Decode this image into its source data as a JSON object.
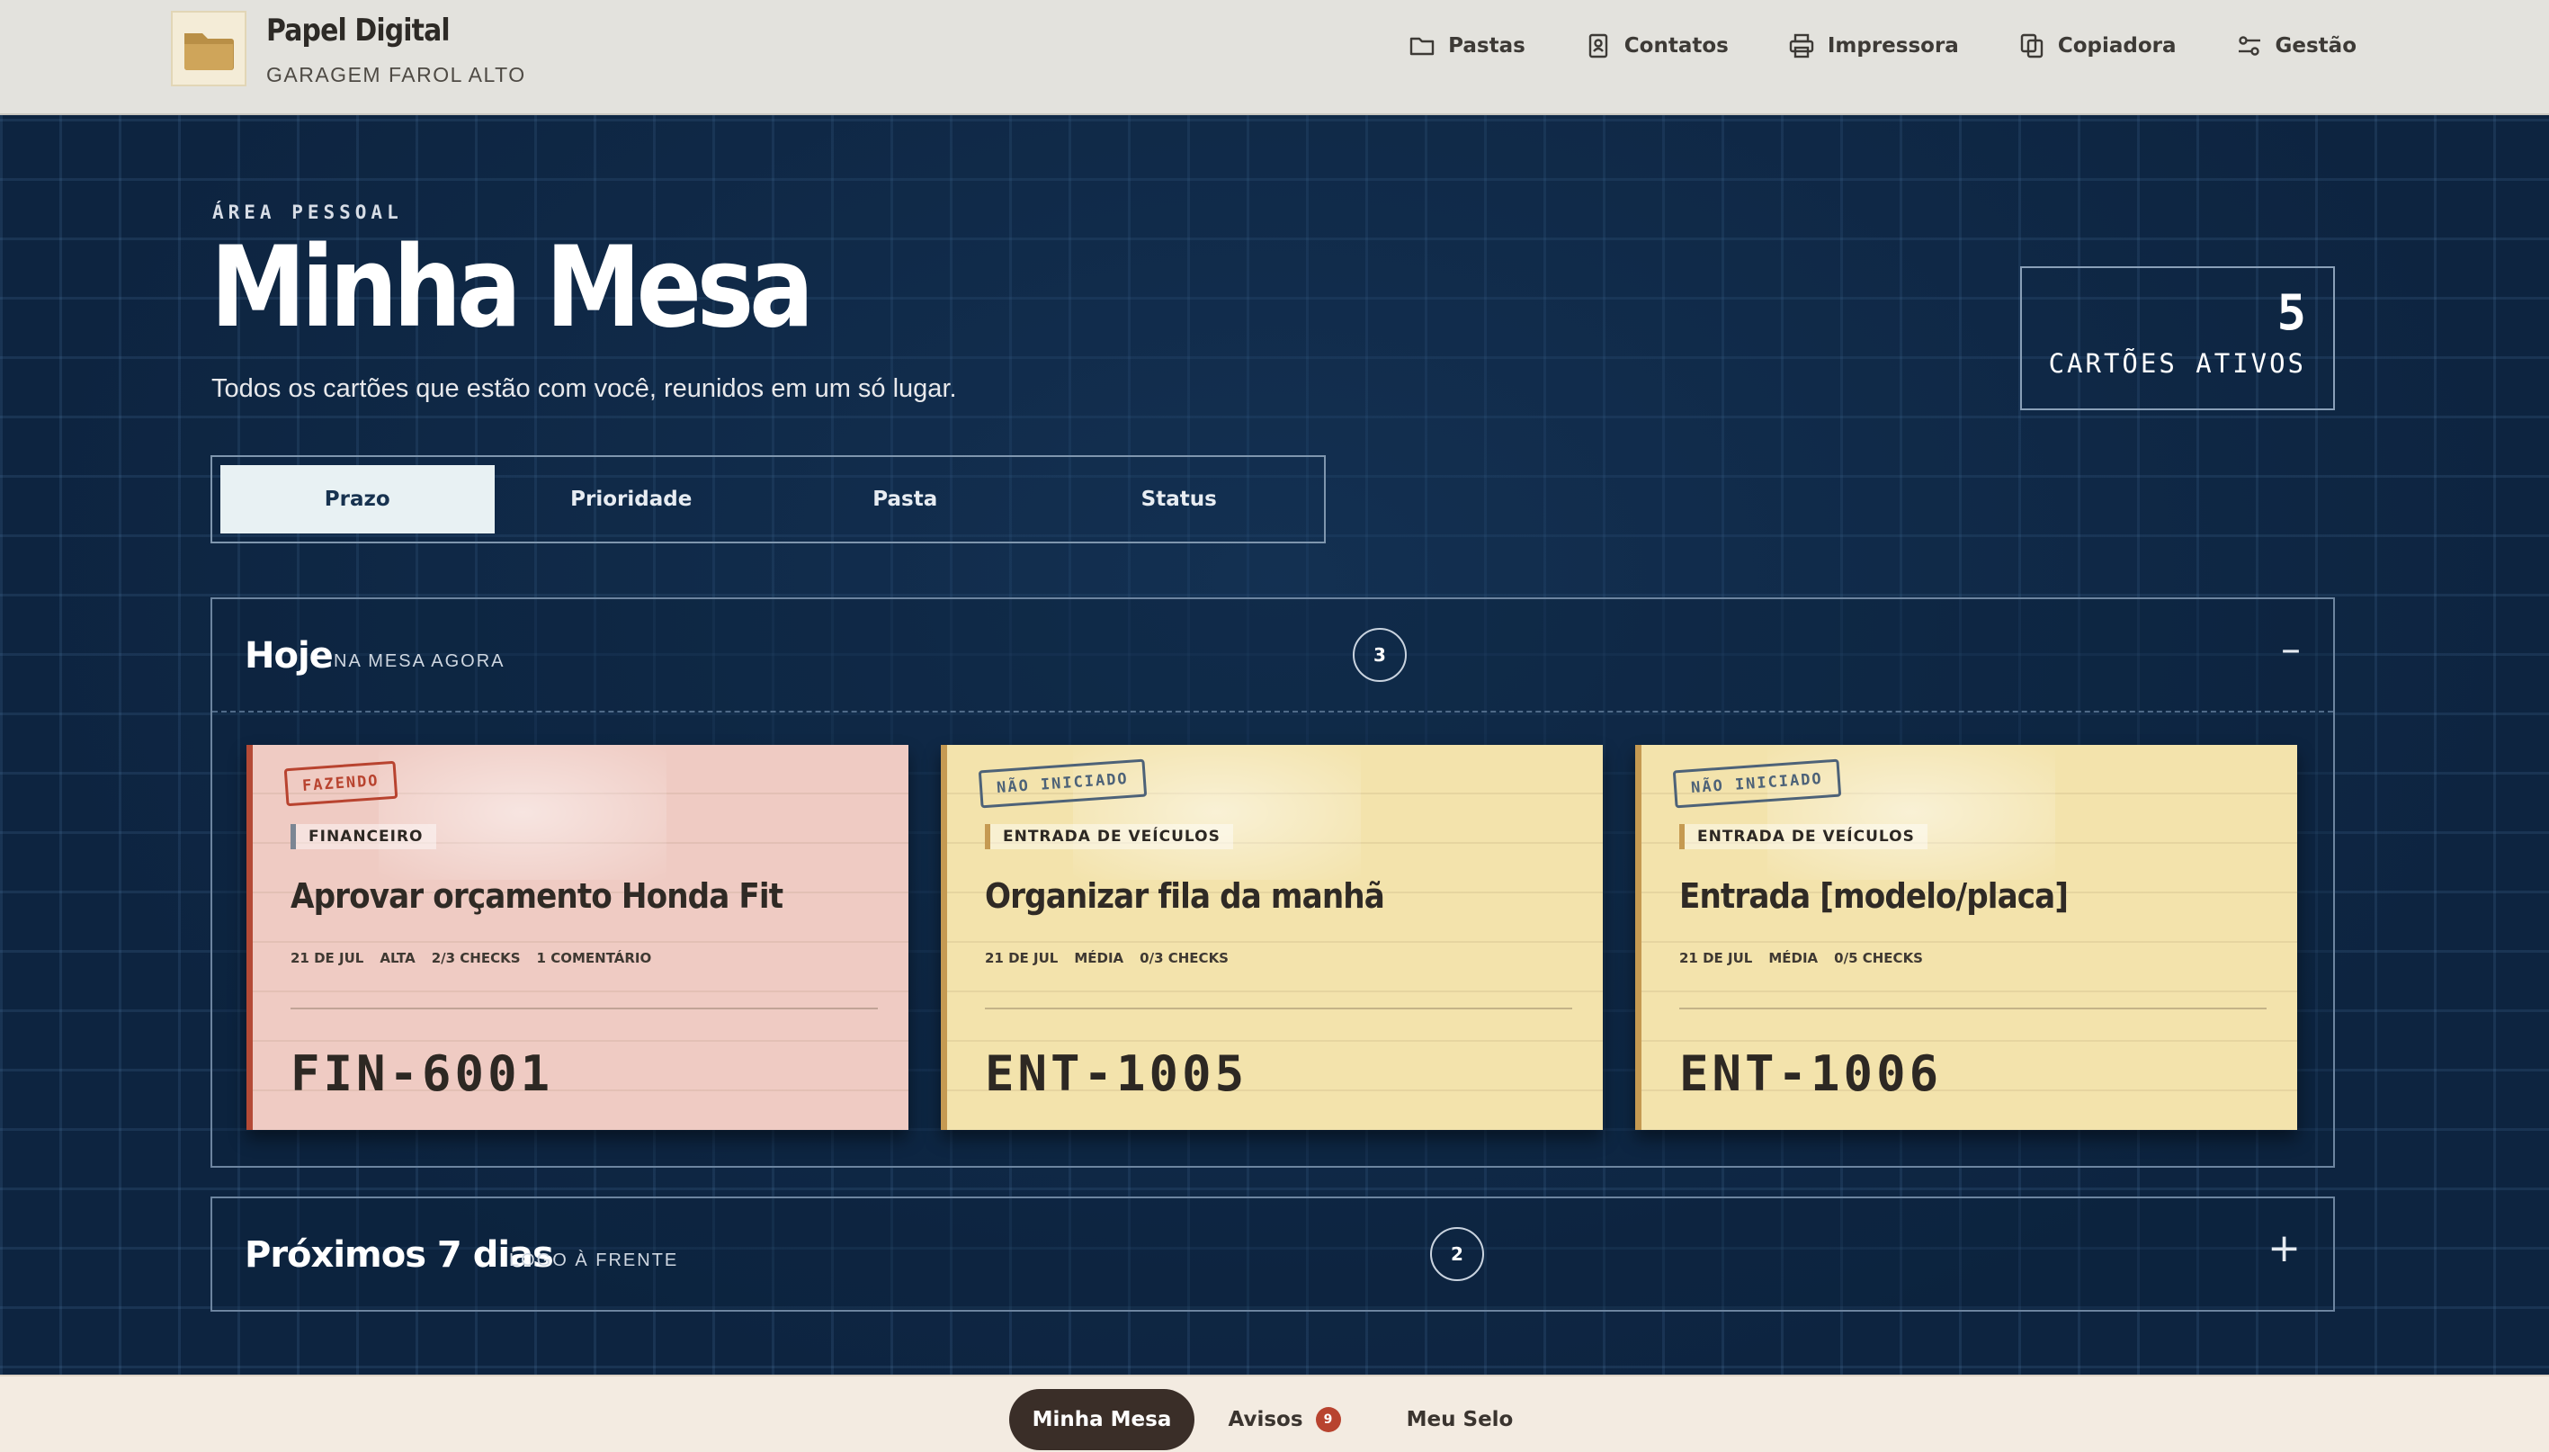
{
  "brand": {
    "name": "Papel Digital",
    "subtitle": "GARAGEM FAROL ALTO"
  },
  "nav": [
    {
      "label": "Pastas",
      "icon": "folder-icon"
    },
    {
      "label": "Contatos",
      "icon": "contact-card-icon"
    },
    {
      "label": "Impressora",
      "icon": "printer-icon"
    },
    {
      "label": "Copiadora",
      "icon": "copy-icon"
    },
    {
      "label": "Gestão",
      "icon": "settings-sliders-icon"
    }
  ],
  "hero": {
    "eyebrow": "ÁREA PESSOAL",
    "title": "Minha Mesa",
    "subtitle": "Todos os cartões que estão com você, reunidos em um só lugar."
  },
  "stats": {
    "count": "5",
    "label": "CARTÕES ATIVOS"
  },
  "tabs": [
    {
      "label": "Prazo",
      "active": true
    },
    {
      "label": "Prioridade",
      "active": false
    },
    {
      "label": "Pasta",
      "active": false
    },
    {
      "label": "Status",
      "active": false
    }
  ],
  "sections": {
    "today": {
      "title": "Hoje",
      "hint": "NA MESA AGORA",
      "count": "3",
      "toggle": "–",
      "cards": [
        {
          "stamp": "FAZENDO",
          "category": "FINANCEIRO",
          "title": "Aprovar orçamento Honda Fit",
          "meta": [
            "21 DE JUL",
            "ALTA",
            "2/3 CHECKS",
            "1 COMENTÁRIO"
          ],
          "code": "FIN-6001"
        },
        {
          "stamp": "NÃO INICIADO",
          "category": "ENTRADA DE VEÍCULOS",
          "title": "Organizar fila da manhã",
          "meta": [
            "21 DE JUL",
            "MÉDIA",
            "0/3 CHECKS"
          ],
          "code": "ENT-1005"
        },
        {
          "stamp": "NÃO INICIADO",
          "category": "ENTRADA DE VEÍCULOS",
          "title": "Entrada [modelo/placa]",
          "meta": [
            "21 DE JUL",
            "MÉDIA",
            "0/5 CHECKS"
          ],
          "code": "ENT-1006"
        }
      ]
    },
    "next": {
      "title": "Próximos 7 dias",
      "hint": "LOGO À FRENTE",
      "count": "2",
      "toggle": "+"
    }
  },
  "bottom_nav": {
    "desk": "Minha Mesa",
    "alerts": "Avisos",
    "alerts_badge": "9",
    "seal": "Meu Selo"
  },
  "colors": {
    "background": "#0d2440",
    "card_pink": "#efcbc3",
    "card_yellow": "#f3e3ac",
    "accent_red": "#b8432f",
    "active_tab": "#e8f1f3"
  }
}
